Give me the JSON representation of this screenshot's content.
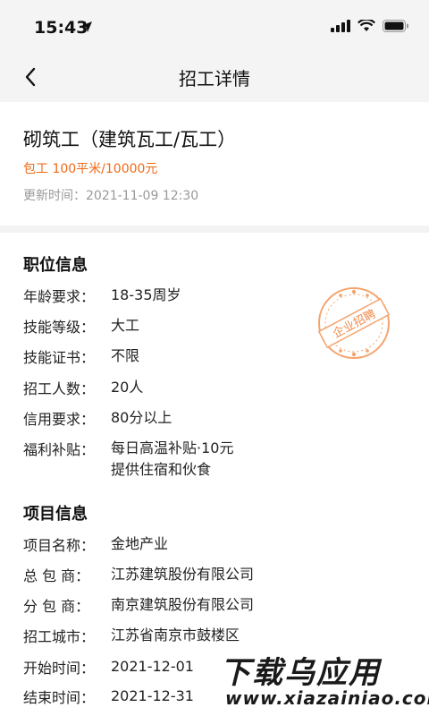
{
  "status_bar": {
    "time": "15:43"
  },
  "nav": {
    "title": "招工详情"
  },
  "job": {
    "title": "砌筑工（建筑瓦工/瓦工）",
    "pay": "包工 100平米/10000元",
    "updated": "更新时间：2021-11-09 12:30"
  },
  "position_info": {
    "title": "职位信息",
    "rows": [
      {
        "label": "年龄要求：",
        "value": "18-35周岁"
      },
      {
        "label": "技能等级：",
        "value": "大工"
      },
      {
        "label": "技能证书：",
        "value": "不限"
      },
      {
        "label": "招工人数：",
        "value": "20人"
      },
      {
        "label": "信用要求：",
        "value": "80分以上"
      },
      {
        "label": "福利补贴：",
        "value": "每日高温补贴·10元",
        "value2": "提供住宿和伙食"
      }
    ],
    "stamp_text": "企业招聘"
  },
  "project_info": {
    "title": "项目信息",
    "rows": [
      {
        "label": "项目名称：",
        "value": "金地产业"
      },
      {
        "label": "总 包 商：",
        "value": "江苏建筑股份有限公司"
      },
      {
        "label": "分 包 商：",
        "value": "南京建筑股份有限公司"
      },
      {
        "label": "招工城市：",
        "value": "江苏省南京市鼓楼区"
      },
      {
        "label": "开始时间：",
        "value": "2021-12-01"
      },
      {
        "label": "结束时间：",
        "value": "2021-12-31"
      }
    ]
  },
  "watermark": {
    "main": "下载乌应用",
    "sub": "www.xiazainiao.com"
  },
  "colors": {
    "accent": "#ef6a17",
    "muted": "#999999",
    "bar_bg": "#f4f4f4"
  },
  "icons": [
    "location-arrow-icon",
    "signal-icon",
    "wifi-icon",
    "battery-icon",
    "back-chevron-icon"
  ]
}
